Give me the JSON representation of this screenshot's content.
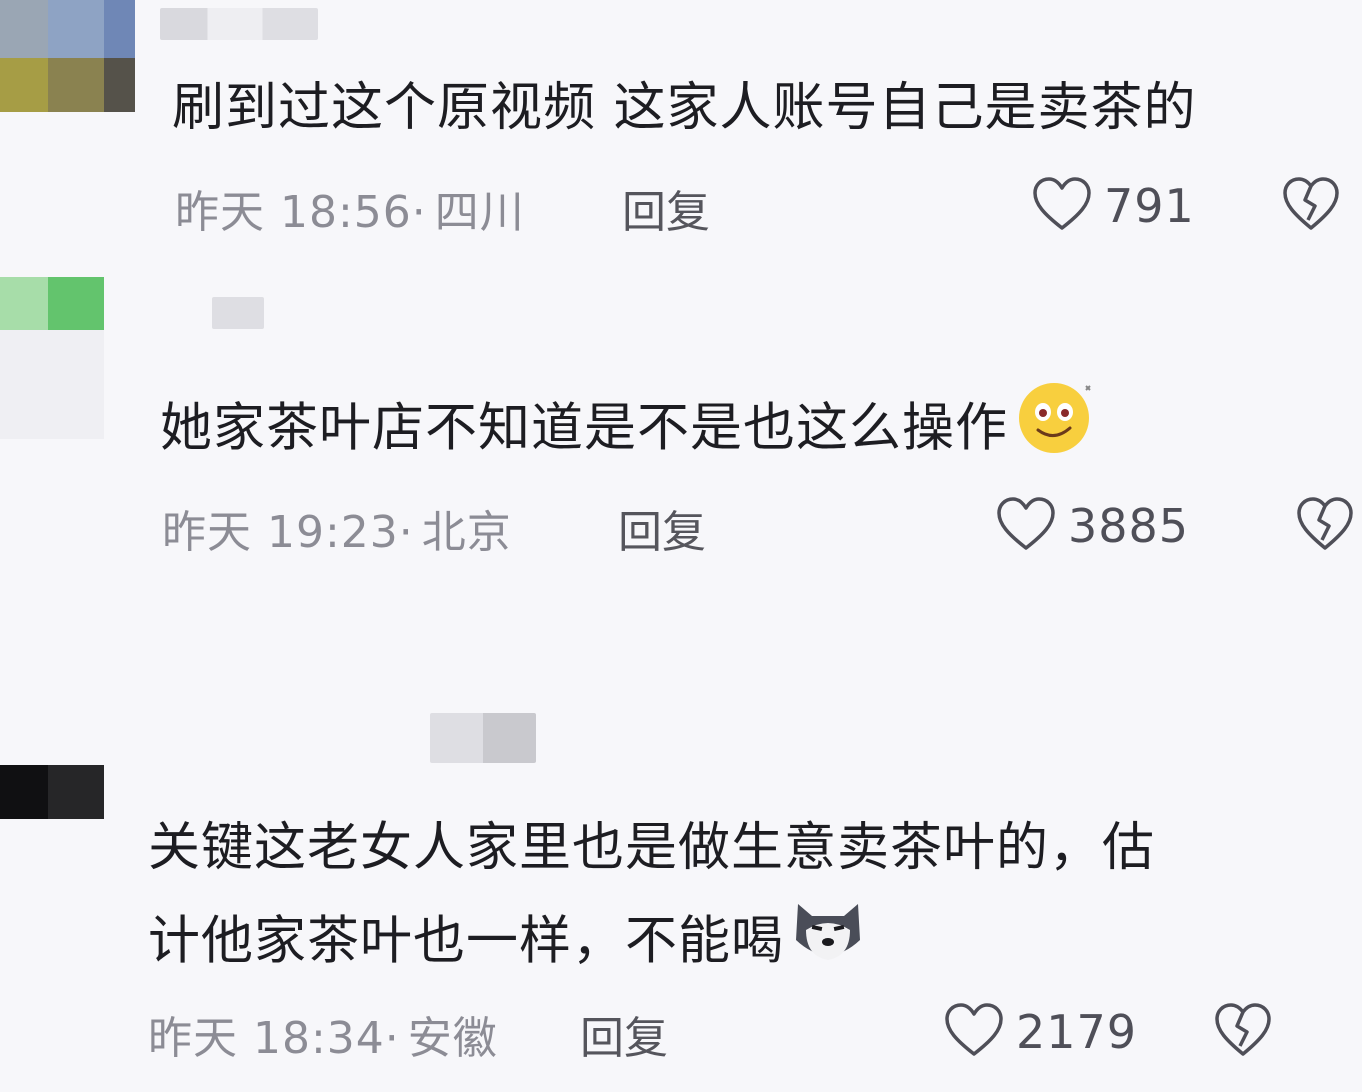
{
  "comments": [
    {
      "text_lines": [
        "刷到过这个原视频 这家人账号自己是卖茶的"
      ],
      "time": "昨天 18:56",
      "location": "四川",
      "reply": "回复",
      "likes": "791",
      "like_icon": "heart-outline-icon",
      "dislike_icon": "broken-heart-icon"
    },
    {
      "text_lines": [
        "她家茶叶店不知道是不是也这么操作"
      ],
      "emoji": "smiling-face-emoji",
      "time": "昨天 19:23",
      "location": "北京",
      "reply": "回复",
      "likes": "3885",
      "like_icon": "heart-outline-icon",
      "dislike_icon": "broken-heart-icon"
    },
    {
      "text_lines": [
        "关键这老女人家里也是做生意卖茶叶的，估",
        "计他家茶叶也一样，不能喝"
      ],
      "emoji": "husky-dog-emoji",
      "time": "昨天 18:34",
      "location": "安徽",
      "reply": "回复",
      "likes": "2179",
      "like_icon": "heart-outline-icon",
      "dislike_icon": "broken-heart-icon"
    }
  ],
  "separator": "·",
  "colors": {
    "background": "#f7f7fa",
    "text": "#1d1d22",
    "meta": "#8c8c95",
    "icon": "#4f4f58"
  }
}
